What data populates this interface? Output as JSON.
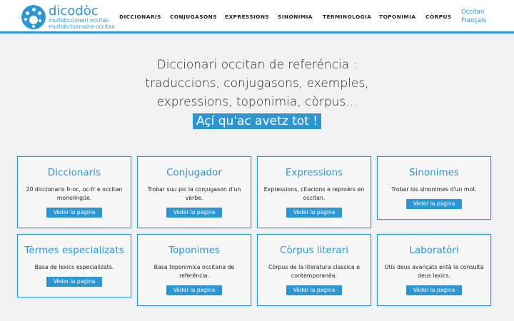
{
  "logo": {
    "name": "dicodòc",
    "sub1": "multidiccionari occitan",
    "sub2": "multidictionnaire occitan"
  },
  "nav": [
    "DICCIONARIS",
    "CONJUGASONS",
    "EXPRESSIONS",
    "SINONIMIA",
    "TERMINOLOGIA",
    "TOPONIMIA",
    "CÒRPUS"
  ],
  "languages": [
    "Occitan",
    "Français"
  ],
  "hero": {
    "line1": "Diccionari occitan de referéncia :",
    "line2": "traduccions, conjugasons, exemples,",
    "line3": "expressions, toponimia, còrpus...",
    "highlight": "Açí qu'ac avetz tot !"
  },
  "cards": [
    {
      "title": "Diccionaris",
      "desc": "20 diccionaris fr-oc, oc-fr e occitan monolingüe.",
      "button": "Vèder la pagina"
    },
    {
      "title": "Conjugador",
      "desc": "Trobar suu pic la conjugason d'un vèrbe.",
      "button": "Vèder la pagina"
    },
    {
      "title": "Expressions",
      "desc": "Expressions, citacions e reproèrs en occitan.",
      "button": "Vèder la pagina"
    },
    {
      "title": "Sinonimes",
      "desc": "Trobar los sinonimes d'un mot.",
      "button": "Vèder la pagina"
    },
    {
      "title": "Tèrmes especializats",
      "desc": "Basa de lexics especializats.",
      "button": "Vèder la pagina"
    },
    {
      "title": "Toponimes",
      "desc": "Basa toponimica occitana de referéncia.",
      "button": "Vèder la pagina"
    },
    {
      "title": "Còrpus literari",
      "desc": "Còrpus de la literatura classica e contemporanèa.",
      "button": "Vèder la pagina"
    },
    {
      "title": "Laboratòri",
      "desc": "Utís deus avançats entà la consulta deus lexics.",
      "button": "Vèder la pagina"
    }
  ],
  "colors": {
    "accent": "#2c96d3",
    "background": "#f2f2f2"
  }
}
